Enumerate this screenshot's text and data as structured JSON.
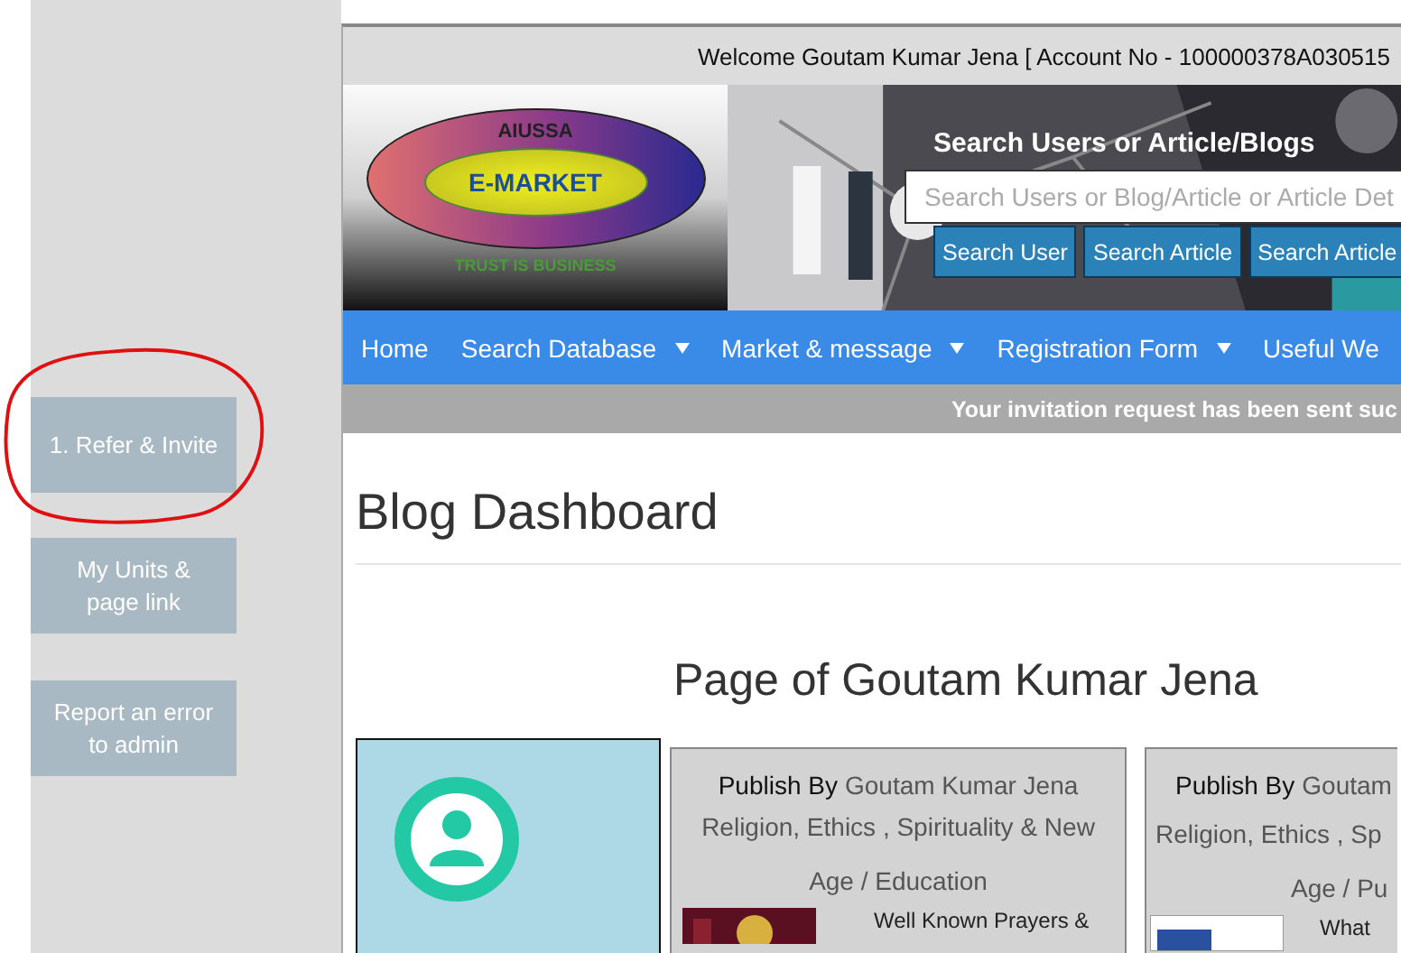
{
  "welcome": "Welcome Goutam Kumar Jena [ Account No - 100000378A030515",
  "logo": {
    "top": "AIUSSA",
    "center": "E-MARKET",
    "tagline": "TRUST IS BUSINESS"
  },
  "search": {
    "title": "Search Users or Article/Blogs",
    "placeholder": "Search Users or Blog/Article or Article Det",
    "buttons": [
      "Search User",
      "Search Article",
      "Search Article"
    ]
  },
  "nav": [
    {
      "label": "Home",
      "dropdown": false
    },
    {
      "label": "Search Database",
      "dropdown": true
    },
    {
      "label": "Market & message",
      "dropdown": true
    },
    {
      "label": "Registration Form",
      "dropdown": true
    },
    {
      "label": "Useful We",
      "dropdown": false
    }
  ],
  "message": "Your invitation request has been sent suc",
  "sidebar": [
    {
      "label": "1. Refer & Invite",
      "annotated": true
    },
    {
      "label": "My Units & page link",
      "annotated": false
    },
    {
      "label": "Report an error to admin",
      "annotated": false
    }
  ],
  "heading": "Blog Dashboard",
  "page_title": "Page of Goutam Kumar Jena",
  "cards": [
    {
      "publish_label": "Publish By",
      "author": "Goutam Kumar Jena",
      "category_lines": [
        "Religion, Ethics , Spirituality & New",
        "Age / Education"
      ],
      "article": "Well Known Prayers &"
    },
    {
      "publish_label": "Publish By",
      "author": "Goutam",
      "category_lines": [
        "Religion, Ethics , Sp",
        "Age / Pu"
      ],
      "article": "What"
    }
  ]
}
